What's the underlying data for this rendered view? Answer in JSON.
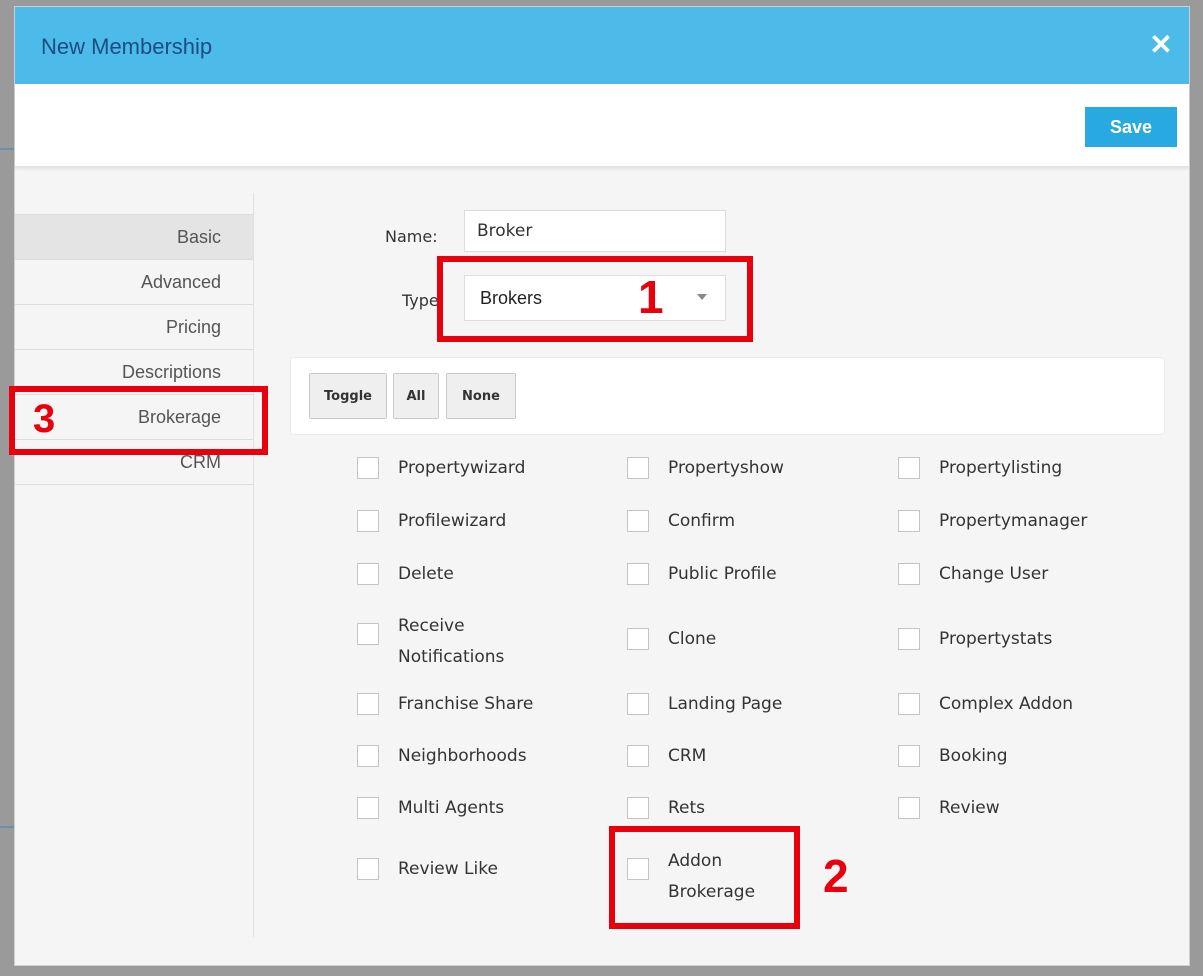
{
  "modal": {
    "title": "New Membership",
    "close_glyph": "✕"
  },
  "toolbar": {
    "save_label": "Save"
  },
  "sidebar": {
    "items": [
      {
        "label": "Basic",
        "active": true
      },
      {
        "label": "Advanced"
      },
      {
        "label": "Pricing"
      },
      {
        "label": "Descriptions"
      },
      {
        "label": "Brokerage"
      },
      {
        "label": "CRM"
      }
    ]
  },
  "form": {
    "name_label": "Name:",
    "name_value": "Broker",
    "type_label": "Type",
    "type_value": "Brokers"
  },
  "buttons": {
    "toggle": "Toggle",
    "all": "All",
    "none": "None"
  },
  "permissions": {
    "col1": [
      "Propertywizard",
      "Profilewizard",
      "Delete",
      "Receive Notifications",
      "Franchise Share",
      "Neighborhoods",
      "Multi Agents",
      "Review Like"
    ],
    "col2": [
      "Propertyshow",
      "Confirm",
      "Public Profile",
      "Clone",
      "Landing Page",
      "CRM",
      "Rets",
      "Addon Brokerage"
    ],
    "col3": [
      "Propertylisting",
      "Propertymanager",
      "Change User",
      "Propertystats",
      "Complex Addon",
      "Booking",
      "Review"
    ]
  },
  "annotations": [
    "1",
    "2",
    "3"
  ],
  "colors": {
    "header": "#4dbbea",
    "save_button": "#29a9e1",
    "annotation": "#e8000d"
  }
}
